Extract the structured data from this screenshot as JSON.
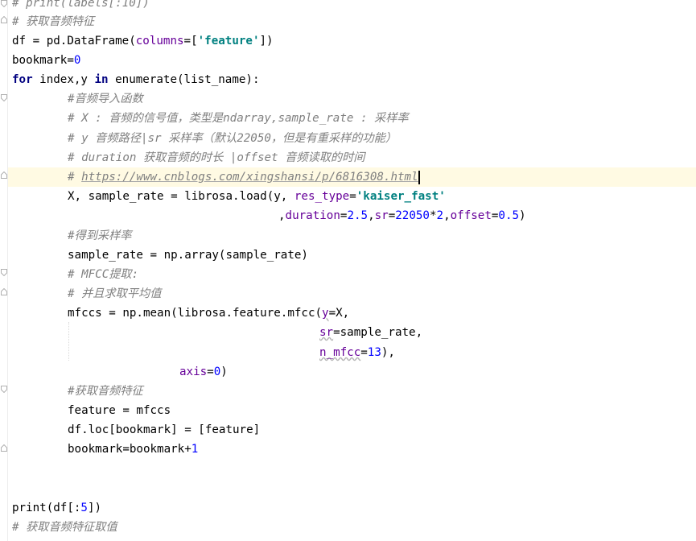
{
  "lines": {
    "l0": {
      "cmt": "# print(labels[:10])"
    },
    "l1": {
      "cmt": "# 获取音频特征"
    },
    "l2": {
      "a": "df = pd.DataFrame(",
      "kwarg": "columns",
      "b": "=[",
      "str": "'feature'",
      "c": "])"
    },
    "l3": {
      "a": "bookmark=",
      "num": "0"
    },
    "l4": {
      "kw1": "for",
      "a": " index,y ",
      "kw2": "in",
      "b": " enumerate(list_name):"
    },
    "l5": {
      "cmt": "#音频导入函数"
    },
    "l6": {
      "cmt": "# X : 音频的信号值，类型是ndarray,sample_rate : 采样率"
    },
    "l7": {
      "cmt": "# y 音频路径|sr 采样率（默认22050，但是有重采样的功能）"
    },
    "l8": {
      "cmt": "# duration 获取音频的时长 |offset 音频读取的时间"
    },
    "l9": {
      "cmt_pre": "# ",
      "url": "https://www.cnblogs.com/xingshansi/p/6816308.html"
    },
    "l10": {
      "a": "X, sample_rate = librosa.load(y, ",
      "kwarg": "res_type",
      "b": "=",
      "str": "'kaiser_fast'"
    },
    "l11": {
      "a": ",",
      "kwarg1": "duration",
      "b": "=",
      "num1": "2.5",
      "c": ",",
      "kwarg2": "sr",
      "d": "=",
      "num2": "22050",
      "e": "*",
      "num3": "2",
      "f": ",",
      "kwarg3": "offset",
      "g": "=",
      "num4": "0.5",
      "h": ")"
    },
    "l12": {
      "cmt": "#得到采样率"
    },
    "l13": {
      "a": "sample_rate = np.array(sample_rate)"
    },
    "l14": {
      "cmt": "# MFCC提取:"
    },
    "l15": {
      "cmt": "# 并且求取平均值"
    },
    "l16": {
      "a": "mfccs = np.mean(librosa.feature.mfcc(",
      "kwarg": "y",
      "b": "=X,"
    },
    "l17": {
      "kwarg": "sr",
      "a": "=sample_rate,"
    },
    "l18": {
      "kwarg": "n_mfcc",
      "a": "=",
      "num": "13",
      "b": "),"
    },
    "l19": {
      "kwarg": "axis",
      "a": "=",
      "num": "0",
      "b": ")"
    },
    "l20": {
      "cmt": "#获取音频特征"
    },
    "l21": {
      "a": "feature = mfccs"
    },
    "l22": {
      "a": "df.loc[bookmark] = [feature]"
    },
    "l23": {
      "a": "bookmark=bookmark+",
      "num": "1"
    },
    "l26": {
      "a": "print(df[:",
      "num": "5",
      "b": "])"
    },
    "l27": {
      "cmt": "# 获取音频特征取值"
    }
  },
  "colors": {
    "keyword": "#000080",
    "string": "#008080",
    "number": "#0000ff",
    "comment": "#808080",
    "kwarg": "#660099",
    "current_line": "#fffae3"
  },
  "icons": [
    "fold-open-icon",
    "fold-close-icon"
  ]
}
